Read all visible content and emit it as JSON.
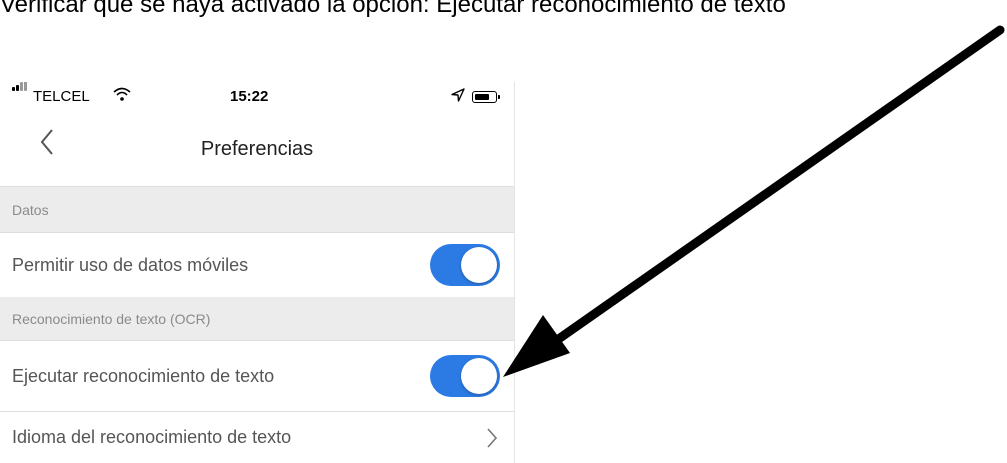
{
  "instruction": "Verificar que se haya activado la opción: Ejecutar reconocimiento de texto",
  "status_bar": {
    "carrier": "TELCEL",
    "time": "15:22",
    "battery_level": 0.6
  },
  "nav": {
    "title": "Preferencias"
  },
  "sections": [
    {
      "header": "Datos",
      "rows": [
        {
          "label": "Permitir uso de datos móviles",
          "toggle_on": true
        }
      ]
    },
    {
      "header": "Reconocimiento de texto (OCR)",
      "rows": [
        {
          "label": "Ejecutar reconocimiento de texto",
          "toggle_on": true
        },
        {
          "label": "Idioma del reconocimiento de texto",
          "control": "chevron-right-icon"
        }
      ]
    }
  ],
  "colors": {
    "accent": "#2c7be5",
    "section_bg": "#ececec",
    "annotation_arrow": "#000000"
  },
  "icons": [
    "signal-icon",
    "wifi-icon",
    "location-arrow-icon",
    "battery-icon",
    "back-chevron-icon",
    "chevron-right-icon",
    "annotation-arrow-icon"
  ]
}
